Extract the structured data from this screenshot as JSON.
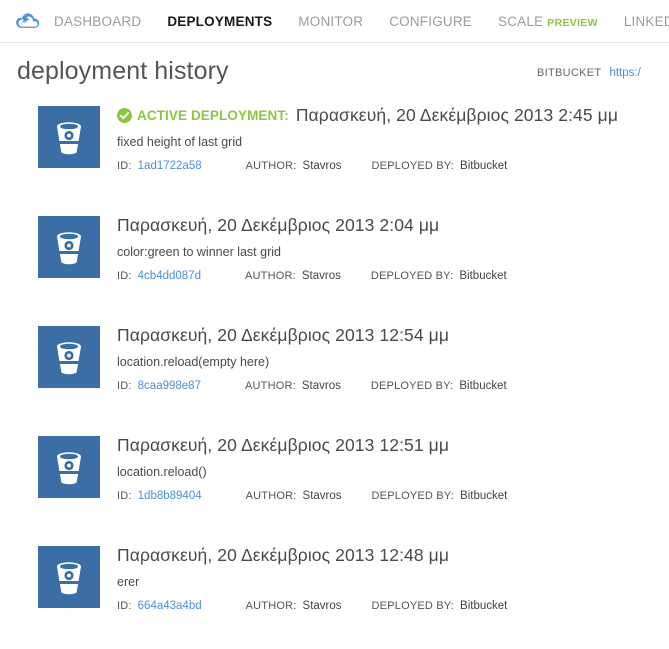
{
  "brand": {
    "icon": "azure-cloud-logo",
    "color": "#4a90d9"
  },
  "topnav": {
    "items": [
      {
        "label": "DASHBOARD",
        "active": false
      },
      {
        "label": "DEPLOYMENTS",
        "active": true
      },
      {
        "label": "MONITOR",
        "active": false
      },
      {
        "label": "CONFIGURE",
        "active": false
      },
      {
        "label": "SCALE",
        "active": false,
        "tag": "PREVIEW"
      },
      {
        "label": "LINKED RESOURCES",
        "active": false
      }
    ],
    "preview_tag_color": "#8cc63f"
  },
  "header": {
    "title": "deployment history",
    "source_label": "BITBUCKET",
    "source_link": "https:/"
  },
  "meta_labels": {
    "id": "ID:",
    "author": "AUTHOR:",
    "deployed_by": "DEPLOYED BY:"
  },
  "active_badge": {
    "label": "ACTIVE DEPLOYMENT:",
    "icon": "check-circle-icon",
    "color": "#8cc63f"
  },
  "deployments": [
    {
      "active": true,
      "avatar_icon": "bitbucket-bucket-icon",
      "date": "Παρασκευή, 20 Δεκέμβριος 2013 2:45 μμ",
      "message": "fixed height of last grid",
      "id": "1ad1722a58",
      "author": "Stavros",
      "deployed_by": "Bitbucket"
    },
    {
      "active": false,
      "avatar_icon": "bitbucket-bucket-icon",
      "date": "Παρασκευή, 20 Δεκέμβριος 2013 2:04 μμ",
      "message": "color:green to winner last grid",
      "id": "4cb4dd087d",
      "author": "Stavros",
      "deployed_by": "Bitbucket"
    },
    {
      "active": false,
      "avatar_icon": "bitbucket-bucket-icon",
      "date": "Παρασκευή, 20 Δεκέμβριος 2013 12:54 μμ",
      "message": "location.reload(empty here)",
      "id": "8caa998e87",
      "author": "Stavros",
      "deployed_by": "Bitbucket"
    },
    {
      "active": false,
      "avatar_icon": "bitbucket-bucket-icon",
      "date": "Παρασκευή, 20 Δεκέμβριος 2013 12:51 μμ",
      "message": "location.reload()",
      "id": "1db8b89404",
      "author": "Stavros",
      "deployed_by": "Bitbucket"
    },
    {
      "active": false,
      "avatar_icon": "bitbucket-bucket-icon",
      "date": "Παρασκευή, 20 Δεκέμβριος 2013 12:48 μμ",
      "message": "erer",
      "id": "664a43a4bd",
      "author": "Stavros",
      "deployed_by": "Bitbucket"
    }
  ]
}
